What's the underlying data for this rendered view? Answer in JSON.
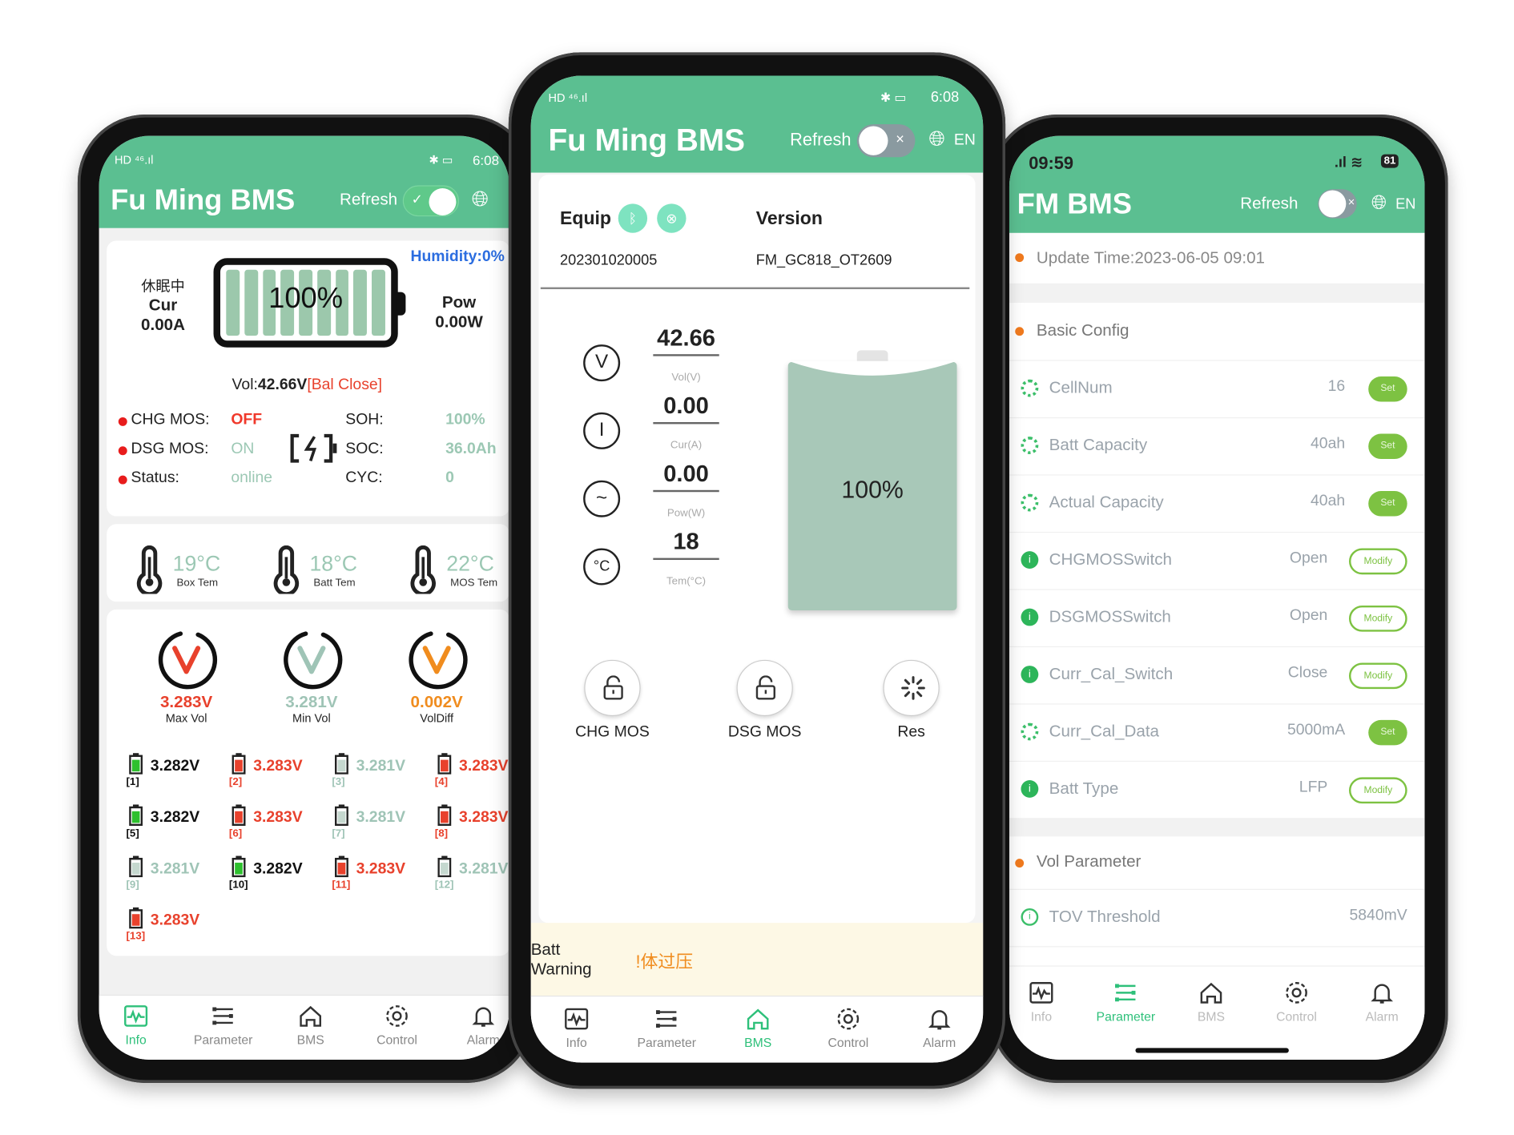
{
  "left": {
    "status_time": "6:08",
    "status_left": "HD ⁴⁶.ıl",
    "title": "Fu Ming BMS",
    "refresh_label": "Refresh",
    "refresh_on": true,
    "humidity": "Humidity:0%",
    "state_cn": "休眠中",
    "cur_label": "Cur",
    "cur_value": "0.00A",
    "soc_percent": "100%",
    "pow_label": "Pow",
    "pow_value": "0.00W",
    "vol_prefix": "Vol:",
    "vol_value": "42.66V",
    "bal_status": "[Bal Close]",
    "status_rows": [
      {
        "label": "CHG MOS:",
        "value": "OFF",
        "color": "#f0392b",
        "bold": true
      },
      {
        "label": "DSG MOS:",
        "value": "ON",
        "color": "#9cc8b4"
      },
      {
        "label": "Status:",
        "value": "online",
        "color": "#9cc8b4"
      }
    ],
    "stat_rows": [
      {
        "label": "SOH:",
        "value": "100%"
      },
      {
        "label": "SOC:",
        "value": "36.0Ah"
      },
      {
        "label": "CYC:",
        "value": "0"
      }
    ],
    "temps": [
      {
        "value": "19°C",
        "label": "Box Tem"
      },
      {
        "value": "18°C",
        "label": "Batt Tem"
      },
      {
        "value": "22°C",
        "label": "MOS Tem"
      }
    ],
    "gauges": [
      {
        "value": "3.283V",
        "label": "Max Vol",
        "color": "#e8412c"
      },
      {
        "value": "3.281V",
        "label": "Min Vol",
        "color": "#9fc4b6"
      },
      {
        "value": "0.002V",
        "label": "VolDiff",
        "color": "#f08c1e"
      }
    ],
    "cells": [
      {
        "v": "3.282V",
        "i": "[1]",
        "s": "mid"
      },
      {
        "v": "3.283V",
        "i": "[2]",
        "s": "max"
      },
      {
        "v": "3.281V",
        "i": "[3]",
        "s": "min"
      },
      {
        "v": "3.283V",
        "i": "[4]",
        "s": "max"
      },
      {
        "v": "3.282V",
        "i": "[5]",
        "s": "mid"
      },
      {
        "v": "3.283V",
        "i": "[6]",
        "s": "max"
      },
      {
        "v": "3.281V",
        "i": "[7]",
        "s": "min"
      },
      {
        "v": "3.283V",
        "i": "[8]",
        "s": "max"
      },
      {
        "v": "3.281V",
        "i": "[9]",
        "s": "min"
      },
      {
        "v": "3.282V",
        "i": "[10]",
        "s": "mid"
      },
      {
        "v": "3.283V",
        "i": "[11]",
        "s": "max"
      },
      {
        "v": "3.281V",
        "i": "[12]",
        "s": "min"
      },
      {
        "v": "3.283V",
        "i": "[13]",
        "s": "max"
      }
    ],
    "active_tab": 0
  },
  "middle": {
    "status_time": "6:08",
    "status_left": "HD ⁴⁶.ıl",
    "title": "Fu Ming BMS",
    "refresh_label": "Refresh",
    "refresh_on": false,
    "lang": "EN",
    "equip_label": "Equip",
    "version_label": "Version",
    "equip_value": "202301020005",
    "version_value": "FM_GC818_OT2609",
    "metrics": [
      {
        "icon": "voltage-icon",
        "glyph": "V",
        "value": "42.66",
        "label": "Vol(V)"
      },
      {
        "icon": "current-icon",
        "glyph": "I",
        "value": "0.00",
        "label": "Cur(A)"
      },
      {
        "icon": "power-icon",
        "glyph": "~",
        "value": "0.00",
        "label": "Pow(W)"
      },
      {
        "icon": "temperature-icon",
        "glyph": "°C",
        "value": "18",
        "label": "Tem(°C)"
      }
    ],
    "battery_percent": "100%",
    "battery_level": 100,
    "controls": [
      {
        "label": "CHG MOS",
        "icon": "unlock-icon"
      },
      {
        "label": "DSG MOS",
        "icon": "unlock-icon"
      },
      {
        "label": "Res",
        "icon": "loading-icon"
      }
    ],
    "warning_label": "Batt Warning",
    "warning_value": "!体过压",
    "active_tab": 2
  },
  "right": {
    "status_time": "09:59",
    "battery_level": "81",
    "title": "FM BMS",
    "refresh_label": "Refresh",
    "refresh_on": false,
    "lang": "EN",
    "update_time": "Update Time:2023-06-05 09:01",
    "section_basic": "Basic Config",
    "params": [
      {
        "icon": "gear",
        "name": "CellNum",
        "value": "16",
        "action": "Set"
      },
      {
        "icon": "gear",
        "name": "Batt Capacity",
        "value": "40ah",
        "action": "Set"
      },
      {
        "icon": "gear",
        "name": "Actual Capacity",
        "value": "40ah",
        "action": "Set"
      },
      {
        "icon": "info",
        "name": "CHGMOSSwitch",
        "value": "Open",
        "action": "Modify"
      },
      {
        "icon": "info",
        "name": "DSGMOSSwitch",
        "value": "Open",
        "action": "Modify"
      },
      {
        "icon": "info",
        "name": "Curr_Cal_Switch",
        "value": "Close",
        "action": "Modify"
      },
      {
        "icon": "gear",
        "name": "Curr_Cal_Data",
        "value": "5000mA",
        "action": "Set"
      },
      {
        "icon": "info",
        "name": "Batt Type",
        "value": "LFP",
        "action": "Modify"
      }
    ],
    "section_vol": "Vol Parameter",
    "vol_params": [
      {
        "name": "TOV Threshold",
        "value": "5840mV"
      }
    ],
    "active_tab": 1
  },
  "nav": [
    {
      "label": "Info",
      "icon": "waveform-icon"
    },
    {
      "label": "Parameter",
      "icon": "sliders-icon"
    },
    {
      "label": "BMS",
      "icon": "home-icon"
    },
    {
      "label": "Control",
      "icon": "gear-icon"
    },
    {
      "label": "Alarm",
      "icon": "bell-icon"
    }
  ],
  "colors": {
    "header_green": "#5bbf91",
    "set_green": "#7dc242",
    "max_red": "#e8412c",
    "min_grey_green": "#9fc4b6",
    "diff_orange": "#f08c1e",
    "humidity_blue": "#2b6de0"
  }
}
